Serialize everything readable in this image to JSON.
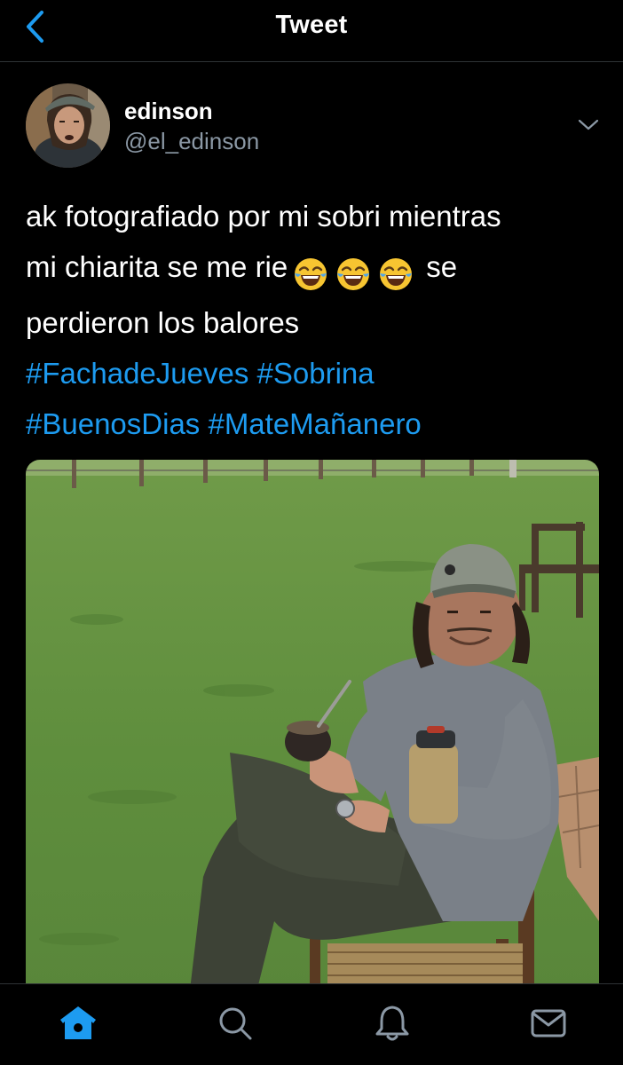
{
  "header": {
    "title": "Tweet",
    "back_icon": "chevron-left-icon",
    "accent_color": "#1d9bf0"
  },
  "tweet": {
    "author": {
      "name": "edinson",
      "handle": "@el_edinson",
      "avatar_icon": "profile-photo"
    },
    "more_icon": "chevron-down-icon",
    "text_lines": [
      "ak fotografiado por mi sobri mientras",
      "mi chiarita se me rie",
      "se",
      "perdieron los balores"
    ],
    "emoji": [
      "😂",
      "😂",
      "😂"
    ],
    "hashtags_line1": [
      "#FachadeJueves",
      "#Sobrina"
    ],
    "hashtags_line2": [
      "#BuenosDias",
      "#MateMañanero"
    ],
    "photo_description_icon": "tweet-photo"
  },
  "tabbar": {
    "items": [
      {
        "icon": "home-icon",
        "active": true
      },
      {
        "icon": "search-icon",
        "active": false
      },
      {
        "icon": "bell-icon",
        "active": false
      },
      {
        "icon": "mail-icon",
        "active": false
      }
    ],
    "active_color": "#1d9bf0",
    "inactive_color": "#8b98a5"
  }
}
